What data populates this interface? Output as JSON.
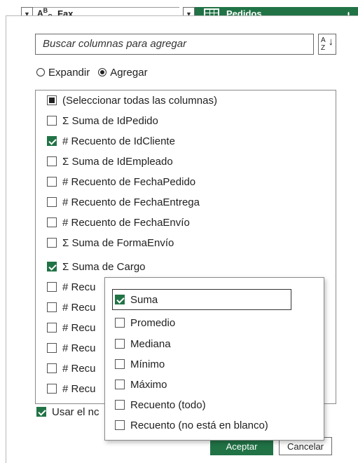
{
  "header": {
    "col1": "Fax",
    "col1_type": "A B C",
    "col2": "Pedidos",
    "col3_partial": "ᵻ"
  },
  "search": {
    "placeholder": "Buscar columnas para agregar"
  },
  "sort_icon": "sort-az-icon",
  "mode": {
    "options": [
      "Expandir",
      "Agregar"
    ],
    "selected": "Agregar"
  },
  "columns": [
    {
      "label": "(Seleccionar todas las columnas)",
      "state": "partial"
    },
    {
      "label": "Σ Suma de IdPedido",
      "state": "unchecked"
    },
    {
      "label": "# Recuento de IdCliente",
      "state": "checked"
    },
    {
      "label": "Σ Suma de IdEmpleado",
      "state": "unchecked"
    },
    {
      "label": "# Recuento de FechaPedido",
      "state": "unchecked"
    },
    {
      "label": "# Recuento de FechaEntrega",
      "state": "unchecked"
    },
    {
      "label": "# Recuento de FechaEnvío",
      "state": "unchecked"
    },
    {
      "label": "Σ Suma de FormaEnvío",
      "state": "unchecked"
    },
    {
      "label": "Σ Suma de Cargo",
      "state": "checked"
    },
    {
      "label": "# Recu",
      "state": "unchecked"
    },
    {
      "label": "# Recu",
      "state": "unchecked"
    },
    {
      "label": "# Recu",
      "state": "unchecked"
    },
    {
      "label": "# Recu",
      "state": "unchecked"
    },
    {
      "label": "# Recu",
      "state": "unchecked"
    },
    {
      "label": "# Recu",
      "state": "unchecked"
    }
  ],
  "aggregate_popup": {
    "items": [
      {
        "label": "Suma",
        "checked": true
      },
      {
        "label": "Promedio",
        "checked": false
      },
      {
        "label": "Mediana",
        "checked": false
      },
      {
        "label": "Mínimo",
        "checked": false
      },
      {
        "label": "Máximo",
        "checked": false
      },
      {
        "label": "Recuento (todo)",
        "checked": false
      },
      {
        "label": "Recuento (no está en blanco)",
        "checked": false
      }
    ]
  },
  "footer": {
    "prefix_checkbox_label": "Usar el nc",
    "prefix_checked": true,
    "ok": "Aceptar",
    "cancel": "Cancelar"
  },
  "colors": {
    "accent": "#217346",
    "highlight_row": "#b9b9b9"
  }
}
